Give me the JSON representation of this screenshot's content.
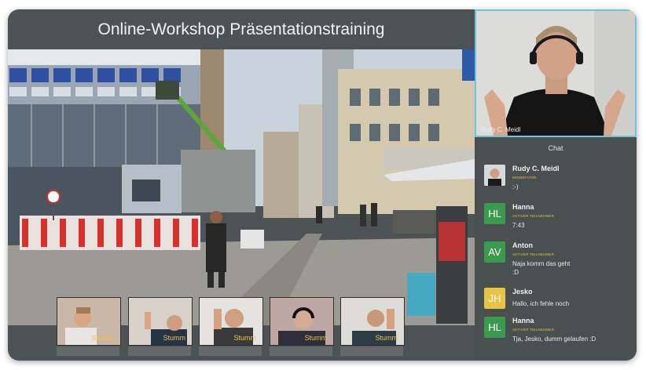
{
  "window": {
    "title": "Online-Workshop Präsentationstraining"
  },
  "colors": {
    "chat_role": "#e6c34a",
    "speaker_border": "#6fc3dc",
    "avatar_green": "#3a9a4e",
    "avatar_yellow": "#e8c346"
  },
  "thumbnails": [
    {
      "mute_label": "Stumm"
    },
    {
      "mute_label": "Stumm"
    },
    {
      "mute_label": "Stumm"
    },
    {
      "mute_label": "Stumm"
    },
    {
      "mute_label": "Stumm"
    }
  ],
  "speaker": {
    "name": "Rudy C. Meidl"
  },
  "chat": {
    "title": "Chat",
    "messages": [
      {
        "author": "Rudy C. Meidl",
        "role": "MODERATOR",
        "text": ":-)",
        "avatar": "photo"
      },
      {
        "author": "Hanna",
        "role": "AKTIVER TEILNEHMER",
        "text": "7:43",
        "avatar": "HL"
      },
      {
        "author": "Anton",
        "role": "AKTIVER TEILNEHMER",
        "text": "Naja komm das geht\n:D",
        "avatar": "AV"
      },
      {
        "author": "Jesko",
        "role": "",
        "text": "Hallo, ich fehle noch",
        "avatar": "JH"
      },
      {
        "author": "Hanna",
        "role": "AKTIVER TEILNEHMER",
        "text": "Tja, Jesko, dumm gelaufen :D",
        "avatar": "HL"
      }
    ]
  }
}
